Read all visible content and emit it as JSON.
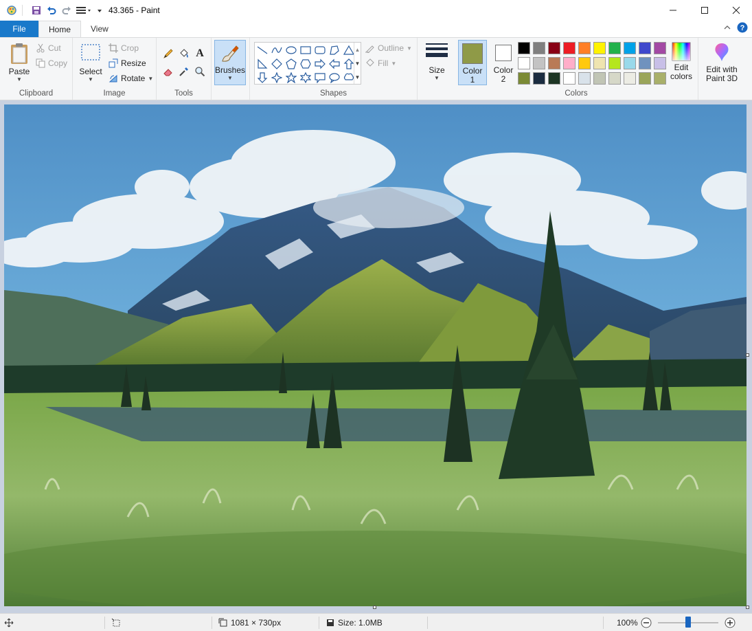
{
  "window": {
    "title": "43.365 - Paint",
    "minimize": "—",
    "maximize": "☐",
    "close": "✕"
  },
  "tabs": {
    "file": "File",
    "home": "Home",
    "view": "View"
  },
  "clipboard": {
    "paste": "Paste",
    "cut": "Cut",
    "copy": "Copy",
    "group": "Clipboard"
  },
  "image": {
    "select": "Select",
    "crop": "Crop",
    "resize": "Resize",
    "rotate": "Rotate",
    "group": "Image"
  },
  "tools": {
    "group": "Tools",
    "text_glyph": "A"
  },
  "brushes": {
    "label": "Brushes"
  },
  "shapes": {
    "outline": "Outline",
    "fill": "Fill",
    "group": "Shapes"
  },
  "size": {
    "label": "Size"
  },
  "colors": {
    "color1_label": "Color",
    "color1_num": "1",
    "color2_label": "Color",
    "color2_num": "2",
    "color1_value": "#8f9a47",
    "color2_value": "#ffffff",
    "edit_colors_line1": "Edit",
    "edit_colors_line2": "colors",
    "paint3d_line1": "Edit with",
    "paint3d_line2": "Paint 3D",
    "group": "Colors",
    "palette_row1": [
      "#000000",
      "#7f7f7f",
      "#880015",
      "#ed1c24",
      "#ff7f27",
      "#fff200",
      "#22b14c",
      "#00a2e8",
      "#3f48cc",
      "#a349a4"
    ],
    "palette_row2": [
      "#ffffff",
      "#c3c3c3",
      "#b97a57",
      "#ffaec9",
      "#ffc90e",
      "#efe4b0",
      "#b5e61d",
      "#99d9ea",
      "#7092be",
      "#c8bfe7"
    ],
    "palette_row3": [
      "#7b8a35",
      "#1b2c40",
      "#1d3524",
      "#ffffff",
      "#d9e2ea",
      "#c1c5b5",
      "#d6d8c8",
      "#ecece4",
      "#9aa55a",
      "#a9b06a"
    ]
  },
  "status": {
    "dimensions": "1081 × 730px",
    "size": "Size: 1.0MB",
    "zoom": "100%",
    "zoom_level": 0.5
  }
}
